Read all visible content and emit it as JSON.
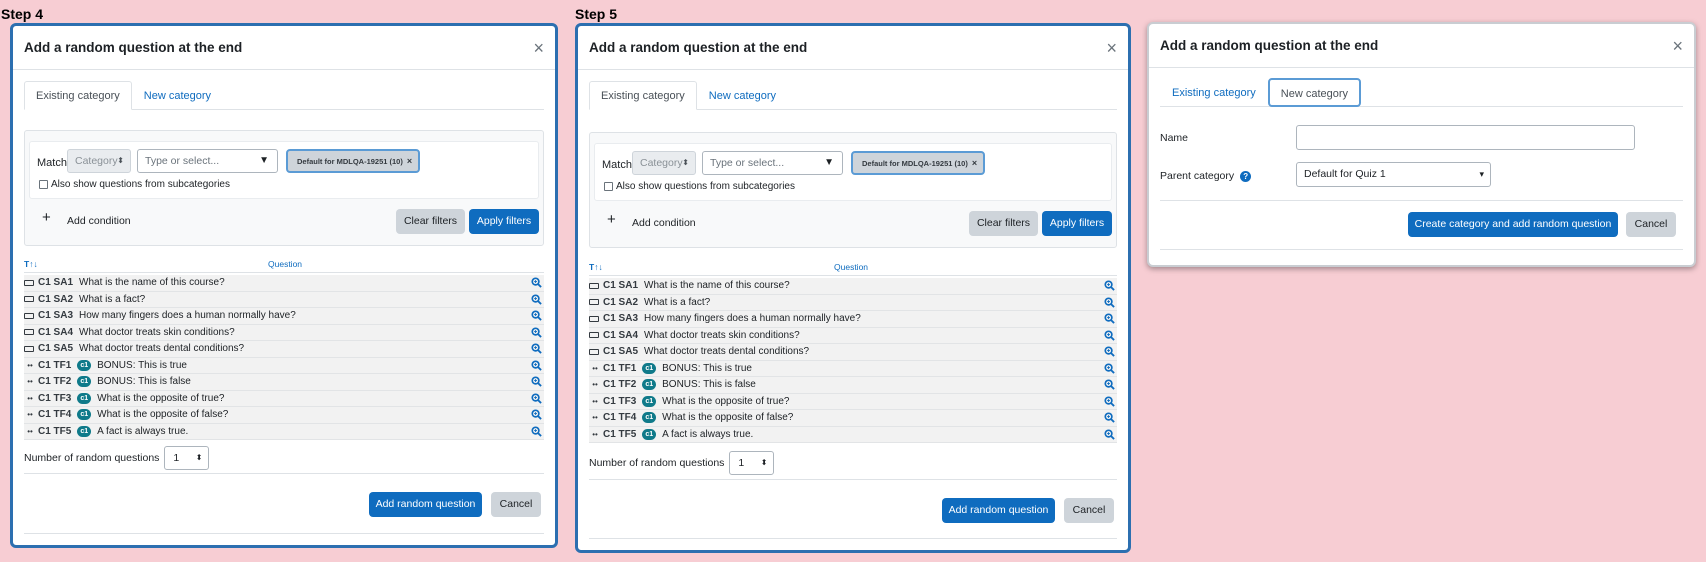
{
  "steps": [
    {
      "label": "Step 4"
    },
    {
      "label": "Step 5"
    }
  ],
  "modal": {
    "title": "Add a random question at the end",
    "close": "×",
    "tabs": [
      "Existing category",
      "New category"
    ]
  },
  "filters": {
    "match_label": "Match",
    "category_select": "Category",
    "type_placeholder": "Type or select...",
    "chip_text": "Default for MDLQA-19251 (10)",
    "chip_x": "×",
    "subcategories_label": "Also show questions from subcategories",
    "add_condition": "Add condition",
    "plus": "+",
    "clear_filters": "Clear filters",
    "apply_filters": "Apply filters"
  },
  "table": {
    "sort_icon": "T↑↓",
    "column_question": "Question",
    "rows": [
      {
        "type": "sa",
        "name": "C1 SA1",
        "badge": "",
        "text": "What is the name of this course?"
      },
      {
        "type": "sa",
        "name": "C1 SA2",
        "badge": "",
        "text": "What is a fact?"
      },
      {
        "type": "sa",
        "name": "C1 SA3",
        "badge": "",
        "text": "How many fingers does a human normally have?"
      },
      {
        "type": "sa",
        "name": "C1 SA4",
        "badge": "",
        "text": "What doctor treats skin conditions?"
      },
      {
        "type": "sa",
        "name": "C1 SA5",
        "badge": "",
        "text": "What doctor treats dental conditions?"
      },
      {
        "type": "tf",
        "name": "C1 TF1",
        "badge": "c1",
        "text": "BONUS: This is true"
      },
      {
        "type": "tf",
        "name": "C1 TF2",
        "badge": "c1",
        "text": "BONUS: This is false"
      },
      {
        "type": "tf",
        "name": "C1 TF3",
        "badge": "c1",
        "text": "What is the opposite of true?"
      },
      {
        "type": "tf",
        "name": "C1 TF4",
        "badge": "c1",
        "text": "What is the opposite of false?"
      },
      {
        "type": "tf",
        "name": "C1 TF5",
        "badge": "c1",
        "text": "A fact is always true."
      }
    ]
  },
  "random": {
    "label": "Number of random questions",
    "value": "1",
    "add_button": "Add random question",
    "cancel_button": "Cancel"
  },
  "new_category": {
    "name_label": "Name",
    "name_value": "",
    "parent_label": "Parent category",
    "help": "?",
    "parent_value": "Default for Quiz 1",
    "create_button": "Create category and add random question",
    "cancel_button": "Cancel"
  },
  "colors": {
    "primary": "#0f6cbf",
    "badge": "#0f7a8a",
    "background": "#f7cdd3"
  }
}
